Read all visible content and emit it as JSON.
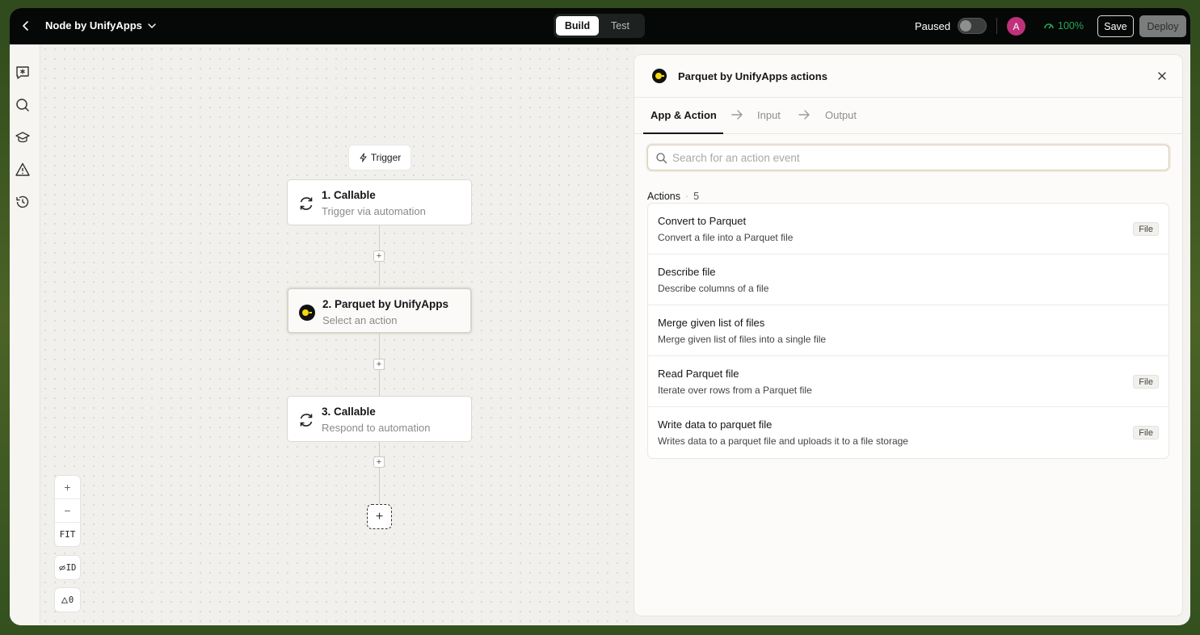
{
  "header": {
    "title": "Node by UnifyApps",
    "modes": [
      {
        "label": "Build",
        "active": true
      },
      {
        "label": "Test",
        "active": false
      }
    ],
    "status_label": "Paused",
    "avatar_initial": "A",
    "health_percent": "100%",
    "save_label": "Save",
    "deploy_label": "Deploy"
  },
  "canvas": {
    "trigger_label": "Trigger",
    "nodes": [
      {
        "title": "1. Callable",
        "subtitle": "Trigger via automation",
        "icon": "refresh-icon"
      },
      {
        "title": "2. Parquet by UnifyApps",
        "subtitle": "Select an action",
        "icon": "parquet-logo-icon"
      },
      {
        "title": "3. Callable",
        "subtitle": "Respond to automation",
        "icon": "refresh-icon"
      }
    ],
    "zoom": {
      "in": "+",
      "out": "−",
      "fit": "FIT"
    },
    "id_toggle": "ID",
    "warnings_count": "0"
  },
  "panel": {
    "title": "Parquet by UnifyApps actions",
    "steps": [
      "App & Action",
      "Input",
      "Output"
    ],
    "search_placeholder": "Search for an action event",
    "actions_label": "Actions",
    "actions_count": "5",
    "actions": [
      {
        "title": "Convert to Parquet",
        "desc": "Convert a file into a Parquet file",
        "tag": "File"
      },
      {
        "title": "Describe file",
        "desc": "Describe columns of a file",
        "tag": ""
      },
      {
        "title": "Merge given list of files",
        "desc": "Merge given list of files into a single file",
        "tag": ""
      },
      {
        "title": "Read Parquet file",
        "desc": "Iterate over rows from a Parquet file",
        "tag": "File"
      },
      {
        "title": "Write data to parquet file",
        "desc": "Writes data to a parquet file and uploads it to a file storage",
        "tag": "File"
      }
    ]
  },
  "colors": {
    "topbar": "#050806",
    "health": "#23a95b",
    "avatar": "#c0317b",
    "parquet_accent": "#f5d90a"
  }
}
